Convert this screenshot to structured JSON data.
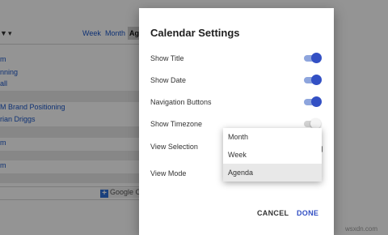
{
  "background": {
    "view_buttons": {
      "week": "Week",
      "month": "Month",
      "agenda": "Agenda"
    },
    "rows": [
      "m",
      "nning",
      "all",
      "M Brand Positioning",
      "rian Driggs",
      "m",
      "m"
    ],
    "google_calendar_label": "Google Calendar"
  },
  "dialog": {
    "title": "Calendar Settings",
    "settings": [
      {
        "label": "Show Title",
        "state": "on"
      },
      {
        "label": "Show Date",
        "state": "on"
      },
      {
        "label": "Navigation Buttons",
        "state": "on"
      },
      {
        "label": "Show Timezone",
        "state": "off"
      },
      {
        "label": "View Selection",
        "state": ""
      },
      {
        "label": "View Mode",
        "state": ""
      }
    ],
    "view_mode_menu": {
      "options": [
        "Month",
        "Week",
        "Agenda"
      ],
      "selected": "Agenda"
    },
    "buttons": {
      "cancel": "CANCEL",
      "done": "DONE"
    }
  },
  "colors": {
    "accent": "#3350c4",
    "toggle_track_on": "#8ea5dd",
    "link": "#1a56c8",
    "overlay": "rgba(0,0,0,0.42)"
  },
  "icons": {
    "add": "plus-square-icon",
    "dropdown": "caret-down-icon"
  },
  "watermark": "wsxdn.com"
}
